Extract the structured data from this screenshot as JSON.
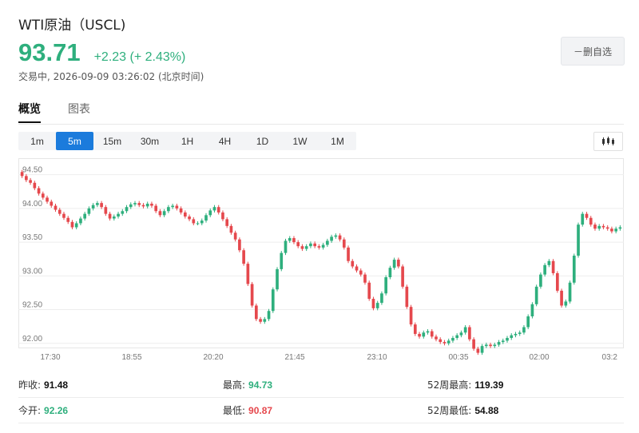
{
  "header": {
    "title": "WTI原油（USCL)",
    "price": "93.71",
    "change": "+2.23 (+ 2.43%)",
    "status_prefix": "交易中,",
    "status_time": "2026-09-09 03:26:02",
    "status_zone": "(北京时间)"
  },
  "remove_button": "－删自选",
  "tabs": [
    "概览",
    "图表"
  ],
  "periods": [
    "1m",
    "5m",
    "15m",
    "30m",
    "1H",
    "4H",
    "1D",
    "1W",
    "1M"
  ],
  "active_period": "5m",
  "colors": {
    "up": "#2eaf7d",
    "down": "#e5484d",
    "accent": "#1b7bdc"
  },
  "chart_data": {
    "type": "candlestick",
    "ylim": [
      91.95,
      94.65
    ],
    "y_ticks": [
      "94.50",
      "94.00",
      "93.50",
      "93.00",
      "92.50",
      "92.00"
    ],
    "x_ticks": [
      "17:30",
      "18:55",
      "20:20",
      "21:45",
      "23:10",
      "00:35",
      "02:00",
      "03:2"
    ],
    "closes": [
      94.48,
      94.42,
      94.38,
      94.3,
      94.22,
      94.16,
      94.1,
      94.04,
      93.98,
      93.92,
      93.86,
      93.8,
      93.72,
      93.78,
      93.85,
      93.92,
      94.0,
      94.05,
      94.08,
      94.02,
      93.92,
      93.85,
      93.88,
      93.92,
      93.96,
      94.02,
      94.06,
      94.08,
      94.05,
      94.03,
      94.07,
      94.04,
      93.96,
      93.9,
      93.96,
      94.02,
      94.04,
      94.0,
      93.94,
      93.88,
      93.84,
      93.78,
      93.78,
      93.82,
      93.9,
      93.97,
      94.02,
      93.94,
      93.84,
      93.74,
      93.64,
      93.54,
      93.38,
      93.18,
      92.88,
      92.56,
      92.36,
      92.32,
      92.36,
      92.48,
      92.8,
      93.1,
      93.34,
      93.52,
      93.56,
      93.5,
      93.44,
      93.4,
      93.44,
      93.48,
      93.44,
      93.42,
      93.46,
      93.52,
      93.58,
      93.6,
      93.54,
      93.42,
      93.22,
      93.14,
      93.08,
      93.02,
      92.9,
      92.66,
      92.52,
      92.6,
      92.74,
      92.98,
      93.12,
      93.24,
      93.14,
      92.84,
      92.54,
      92.28,
      92.14,
      92.1,
      92.16,
      92.18,
      92.1,
      92.06,
      92.02,
      92.0,
      92.04,
      92.08,
      92.12,
      92.16,
      92.24,
      92.06,
      91.92,
      91.86,
      91.96,
      91.98,
      91.96,
      91.98,
      92.02,
      92.04,
      92.08,
      92.12,
      92.14,
      92.16,
      92.24,
      92.4,
      92.58,
      92.84,
      93.02,
      93.16,
      93.22,
      93.04,
      92.78,
      92.56,
      92.62,
      92.9,
      93.3,
      93.76,
      93.92,
      93.86,
      93.76,
      93.7,
      93.74,
      93.72,
      93.7,
      93.66,
      93.7,
      93.72
    ]
  },
  "stats": [
    [
      {
        "label": "昨收:",
        "value": "91.48"
      },
      {
        "label": "最高:",
        "value": "94.73"
      },
      {
        "label": "52周最高:",
        "value": "119.39"
      }
    ],
    [
      {
        "label": "今开:",
        "value": "92.26"
      },
      {
        "label": "最低:",
        "value": "90.87"
      },
      {
        "label": "52周最低:",
        "value": "54.88"
      }
    ]
  ]
}
